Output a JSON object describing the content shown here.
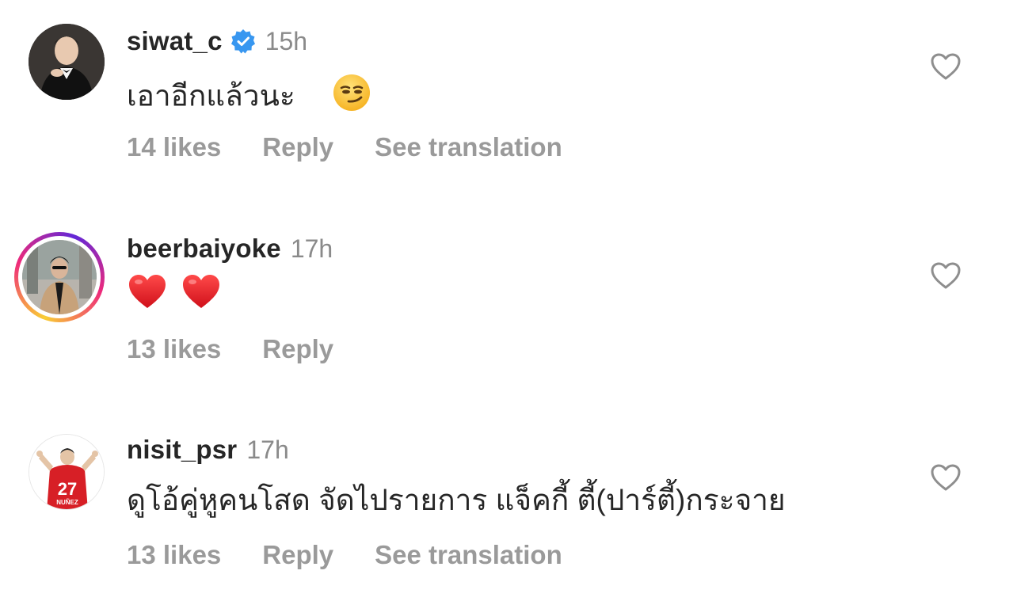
{
  "comments": [
    {
      "username": "siwat_c",
      "verified": true,
      "time": "15h",
      "text": "เอาอีกแล้วนะ",
      "emoji": "😏",
      "likes": "14 likes",
      "reply": "Reply",
      "translate": "See translation",
      "avatar_ring": false
    },
    {
      "username": "beerbaiyoke",
      "verified": false,
      "time": "17h",
      "text": "",
      "emoji": "❤️❤️",
      "likes": "13 likes",
      "reply": "Reply",
      "avatar_ring": true
    },
    {
      "username": "nisit_psr",
      "verified": false,
      "time": "17h",
      "text": "ดูโอ้คู่หูคนโสด จัดไปรายการ แจ็คกี้ ตี้(ปาร์ตี้)กระจาย",
      "likes": "13 likes",
      "reply": "Reply",
      "translate": "See translation",
      "avatar_ring": false,
      "jersey_number": "27",
      "jersey_name": "NUÑEZ"
    }
  ],
  "colors": {
    "text": "#262626",
    "muted": "#8a8a8a",
    "action": "#9a9a9a",
    "verified": "#3897f0"
  },
  "icons": {
    "like": "heart-outline-icon",
    "verified": "verified-badge-icon"
  }
}
